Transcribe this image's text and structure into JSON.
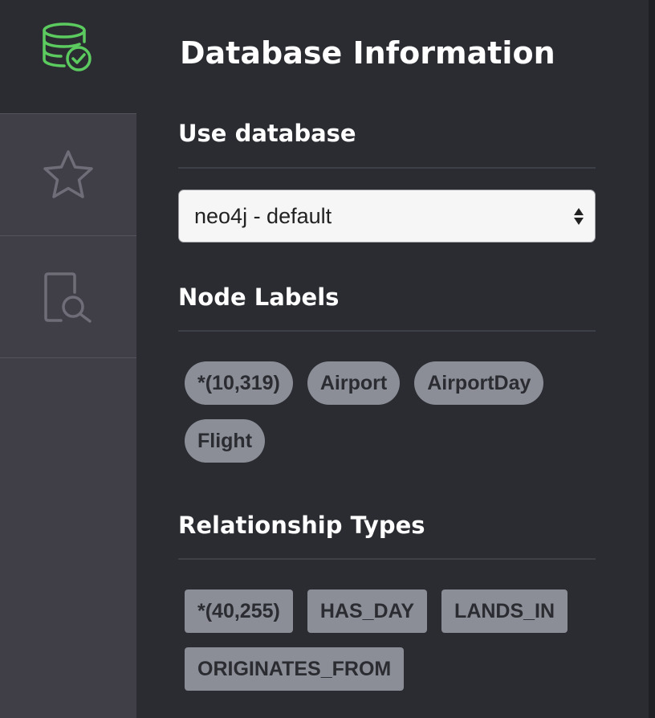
{
  "sidebar": {
    "items": [
      {
        "name": "database",
        "icon": "database-check-icon",
        "active": true,
        "color": "#5ccb5f"
      },
      {
        "name": "favorites",
        "icon": "star-icon",
        "active": false,
        "color": "#6f6d77"
      },
      {
        "name": "guides",
        "icon": "document-search-icon",
        "active": false,
        "color": "#6f6d77"
      }
    ]
  },
  "panel": {
    "title": "Database Information",
    "use_database": {
      "heading": "Use database",
      "selected": "neo4j - default"
    },
    "node_labels": {
      "heading": "Node Labels",
      "items": [
        "*(10,319)",
        "Airport",
        "AirportDay",
        "Flight"
      ]
    },
    "relationship_types": {
      "heading": "Relationship Types",
      "items": [
        "*(40,255)",
        "HAS_DAY",
        "LANDS_IN",
        "ORIGINATES_FROM"
      ]
    }
  }
}
